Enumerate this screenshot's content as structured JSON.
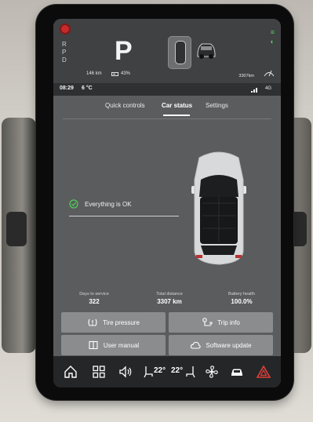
{
  "driver_display": {
    "gear_list": [
      "R",
      "P",
      "D"
    ],
    "current_gear": "P",
    "range": "146 km",
    "battery_percent": "43%",
    "odometer": "3307km"
  },
  "statusbar": {
    "time": "08:29",
    "outside_temp": "6 °C",
    "network": "4G"
  },
  "tabs": [
    {
      "label": "Quick controls"
    },
    {
      "label": "Car status"
    },
    {
      "label": "Settings"
    }
  ],
  "active_tab": "Car status",
  "car_status": {
    "status_message": "Everything is OK",
    "stats": [
      {
        "label": "Days to service",
        "value": "322"
      },
      {
        "label": "Total distance",
        "value": "3307 km"
      },
      {
        "label": "Battery health",
        "value": "100.0%"
      }
    ]
  },
  "buttons": {
    "tire_pressure": "Tire pressure",
    "trip_info": "Trip info",
    "user_manual": "User manual",
    "software_update": "Software update"
  },
  "dock": {
    "left_temp": "22°",
    "right_temp": "22°"
  },
  "colors": {
    "accent_green": "#4dd05a",
    "warning_red": "#c62a2a",
    "button_bg": "#8a8c8e"
  },
  "icons": [
    "home-icon",
    "apps-grid-icon",
    "volume-icon",
    "seat-heat-icon",
    "fan-icon",
    "car-icon",
    "hazard-icon",
    "checkmark-circle-icon",
    "tire-pressure-icon",
    "trip-info-icon",
    "book-icon",
    "cloud-icon"
  ]
}
